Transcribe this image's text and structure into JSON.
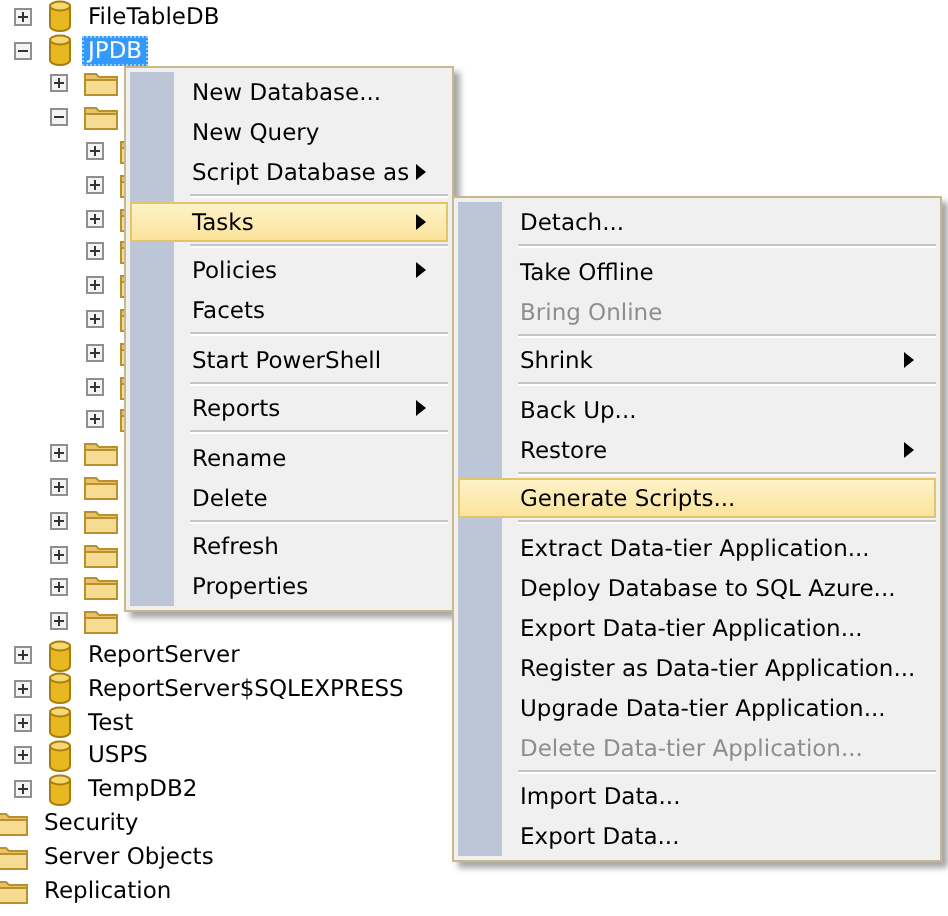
{
  "tree": {
    "databases": [
      {
        "kind": "database",
        "label": "FileTableDB",
        "expanded": false,
        "selected": false
      },
      {
        "kind": "database",
        "label": "JPDB",
        "expanded": true,
        "selected": true,
        "children": [
          {
            "kind": "folder",
            "expanded": false
          },
          {
            "kind": "folder",
            "expanded": true,
            "children": [
              {
                "kind": "folder",
                "expanded": false
              },
              {
                "kind": "folder",
                "expanded": false
              },
              {
                "kind": "folder",
                "expanded": false
              },
              {
                "kind": "folder",
                "expanded": false
              },
              {
                "kind": "folder",
                "expanded": false
              },
              {
                "kind": "folder",
                "expanded": false
              },
              {
                "kind": "folder",
                "expanded": false
              },
              {
                "kind": "folder",
                "expanded": false
              },
              {
                "kind": "folder",
                "expanded": false
              }
            ]
          },
          {
            "kind": "folder",
            "expanded": false
          },
          {
            "kind": "folder",
            "expanded": false
          },
          {
            "kind": "folder",
            "expanded": false
          },
          {
            "kind": "folder",
            "expanded": false
          },
          {
            "kind": "folder",
            "expanded": false
          },
          {
            "kind": "folder",
            "expanded": false
          }
        ]
      },
      {
        "kind": "database",
        "label": "ReportServer",
        "expanded": false,
        "selected": false
      },
      {
        "kind": "database",
        "label": "ReportServer$SQLEXPRESS",
        "expanded": false,
        "selected": false
      },
      {
        "kind": "database",
        "label": "Test",
        "expanded": false,
        "selected": false
      },
      {
        "kind": "database",
        "label": "USPS",
        "expanded": false,
        "selected": false
      },
      {
        "kind": "database",
        "label": "TempDB2",
        "expanded": false,
        "selected": false
      }
    ],
    "folders": [
      {
        "kind": "folder",
        "label": "Security",
        "selected": false
      },
      {
        "kind": "folder",
        "label": "Server Objects",
        "selected": false
      },
      {
        "kind": "folder",
        "label": "Replication",
        "selected": false
      }
    ]
  },
  "context_menu": [
    {
      "kind": "item",
      "label": "New Database...",
      "has_submenu": false,
      "selected": false,
      "disabled": false
    },
    {
      "kind": "item",
      "label": "New Query",
      "has_submenu": false,
      "selected": false,
      "disabled": false
    },
    {
      "kind": "item",
      "label": "Script Database as",
      "has_submenu": true,
      "selected": false,
      "disabled": false
    },
    {
      "kind": "separator"
    },
    {
      "kind": "item",
      "label": "Tasks",
      "has_submenu": true,
      "selected": true,
      "disabled": false
    },
    {
      "kind": "separator"
    },
    {
      "kind": "item",
      "label": "Policies",
      "has_submenu": true,
      "selected": false,
      "disabled": false
    },
    {
      "kind": "item",
      "label": "Facets",
      "has_submenu": false,
      "selected": false,
      "disabled": false
    },
    {
      "kind": "separator"
    },
    {
      "kind": "item",
      "label": "Start PowerShell",
      "has_submenu": false,
      "selected": false,
      "disabled": false
    },
    {
      "kind": "separator"
    },
    {
      "kind": "item",
      "label": "Reports",
      "has_submenu": true,
      "selected": false,
      "disabled": false
    },
    {
      "kind": "separator"
    },
    {
      "kind": "item",
      "label": "Rename",
      "has_submenu": false,
      "selected": false,
      "disabled": false
    },
    {
      "kind": "item",
      "label": "Delete",
      "has_submenu": false,
      "selected": false,
      "disabled": false
    },
    {
      "kind": "separator"
    },
    {
      "kind": "item",
      "label": "Refresh",
      "has_submenu": false,
      "selected": false,
      "disabled": false
    },
    {
      "kind": "item",
      "label": "Properties",
      "has_submenu": false,
      "selected": false,
      "disabled": false
    }
  ],
  "tasks_submenu": [
    {
      "kind": "item",
      "label": "Detach...",
      "has_submenu": false,
      "selected": false,
      "disabled": false
    },
    {
      "kind": "separator"
    },
    {
      "kind": "item",
      "label": "Take Offline",
      "has_submenu": false,
      "selected": false,
      "disabled": false
    },
    {
      "kind": "item",
      "label": "Bring Online",
      "has_submenu": false,
      "selected": false,
      "disabled": true
    },
    {
      "kind": "separator"
    },
    {
      "kind": "item",
      "label": "Shrink",
      "has_submenu": true,
      "selected": false,
      "disabled": false
    },
    {
      "kind": "separator"
    },
    {
      "kind": "item",
      "label": "Back Up...",
      "has_submenu": false,
      "selected": false,
      "disabled": false
    },
    {
      "kind": "item",
      "label": "Restore",
      "has_submenu": true,
      "selected": false,
      "disabled": false
    },
    {
      "kind": "separator"
    },
    {
      "kind": "item",
      "label": "Generate Scripts...",
      "has_submenu": false,
      "selected": true,
      "disabled": false
    },
    {
      "kind": "separator"
    },
    {
      "kind": "item",
      "label": "Extract Data-tier Application...",
      "has_submenu": false,
      "selected": false,
      "disabled": false
    },
    {
      "kind": "item",
      "label": "Deploy Database to SQL Azure...",
      "has_submenu": false,
      "selected": false,
      "disabled": false
    },
    {
      "kind": "item",
      "label": "Export Data-tier Application...",
      "has_submenu": false,
      "selected": false,
      "disabled": false
    },
    {
      "kind": "item",
      "label": "Register as Data-tier Application...",
      "has_submenu": false,
      "selected": false,
      "disabled": false
    },
    {
      "kind": "item",
      "label": "Upgrade Data-tier Application...",
      "has_submenu": false,
      "selected": false,
      "disabled": false
    },
    {
      "kind": "item",
      "label": "Delete Data-tier Application...",
      "has_submenu": false,
      "selected": false,
      "disabled": true
    },
    {
      "kind": "separator"
    },
    {
      "kind": "item",
      "label": "Import Data...",
      "has_submenu": false,
      "selected": false,
      "disabled": false
    },
    {
      "kind": "item",
      "label": "Export Data...",
      "has_submenu": false,
      "selected": false,
      "disabled": false
    }
  ]
}
